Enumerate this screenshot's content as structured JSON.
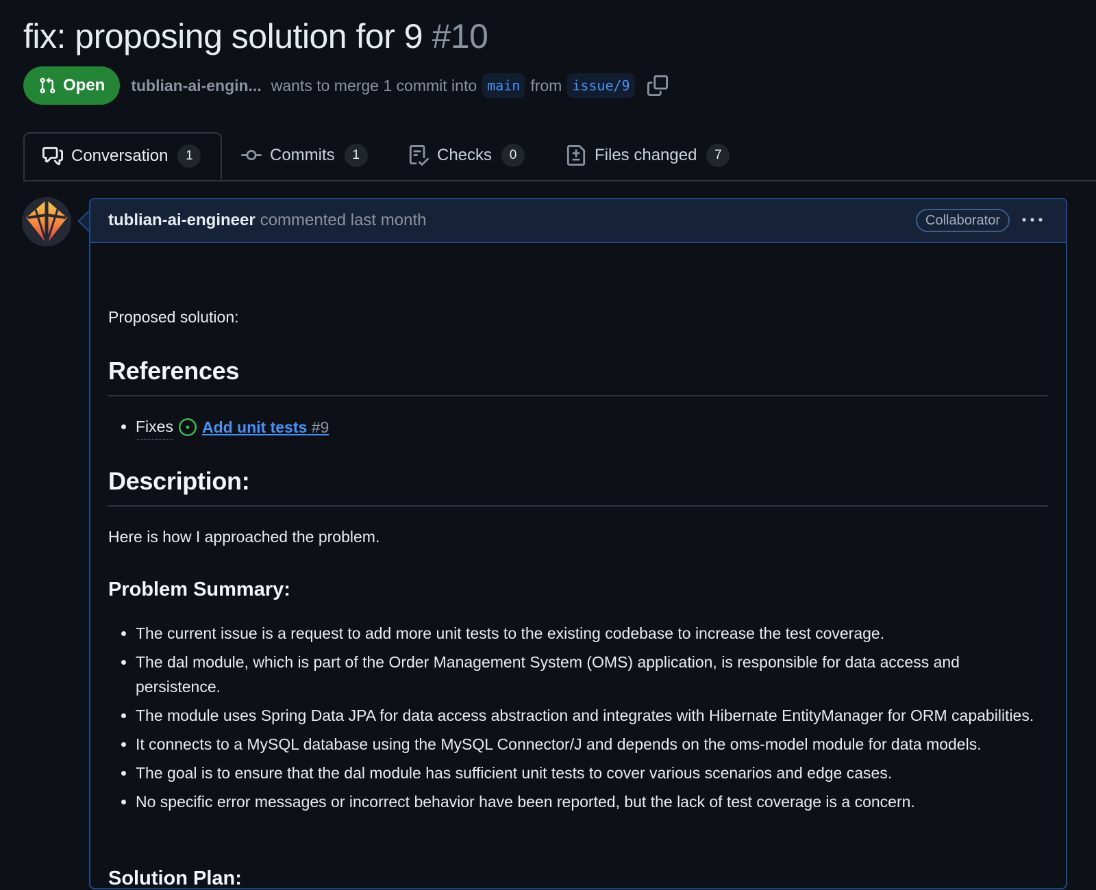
{
  "pr": {
    "title": "fix: proposing solution for 9",
    "number": "#10",
    "state": "Open",
    "author": "tublian-ai-engin...",
    "merge_text": "wants to merge 1 commit into",
    "base_branch": "main",
    "from_text": "from",
    "head_branch": "issue/9"
  },
  "tabs": [
    {
      "label": "Conversation",
      "count": "1"
    },
    {
      "label": "Commits",
      "count": "1"
    },
    {
      "label": "Checks",
      "count": "0"
    },
    {
      "label": "Files changed",
      "count": "7"
    }
  ],
  "comment": {
    "author": "tublian-ai-engineer",
    "action": "commented last month",
    "role": "Collaborator",
    "intro": "Proposed solution:",
    "references_heading": "References",
    "fixes_word": "Fixes",
    "linked_issue_title": "Add unit tests",
    "linked_issue_number": "#9",
    "description_heading": "Description:",
    "description_text": "Here is how I approached the problem.",
    "problem_heading": "Problem Summary:",
    "problem_items": [
      "The current issue is a request to add more unit tests to the existing codebase to increase the test coverage.",
      "The dal module, which is part of the Order Management System (OMS) application, is responsible for data access and persistence.",
      "The module uses Spring Data JPA for data access abstraction and integrates with Hibernate EntityManager for ORM capabilities.",
      "It connects to a MySQL database using the MySQL Connector/J and depends on the oms-model module for data models.",
      "The goal is to ensure that the dal module has sufficient unit tests to cover various scenarios and edge cases.",
      "No specific error messages or incorrect behavior have been reported, but the lack of test coverage is a concern."
    ],
    "solution_heading": "Solution Plan:"
  },
  "icons": {
    "state": "git-pull-request-icon",
    "copy": "copy-icon",
    "conversation": "comment-discussion-icon",
    "commits": "git-commit-icon",
    "checks": "checklist-icon",
    "files": "file-diff-icon",
    "issue": "issue-opened-icon",
    "more": "kebab-horizontal-icon"
  },
  "colors": {
    "background": "#0d1117",
    "open_green": "#238636",
    "link_blue": "#4493f8",
    "comment_header": "#152238"
  }
}
